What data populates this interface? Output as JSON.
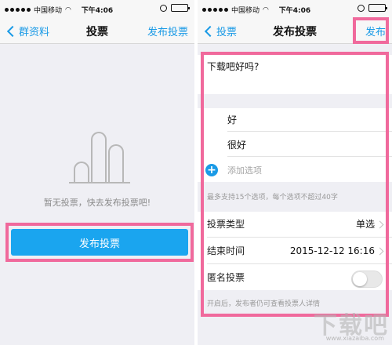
{
  "left": {
    "statusbar": {
      "carrier": "中国移动",
      "time": "下午4:06"
    },
    "navbar": {
      "back_label": "群资料",
      "title": "投票",
      "action_label": "发布投票"
    },
    "empty_text": "暂无投票，快去发布投票吧!",
    "publish_button": "发布投票"
  },
  "right": {
    "statusbar": {
      "carrier": "中国移动",
      "time": "下午4:06"
    },
    "navbar": {
      "back_label": "投票",
      "title": "发布投票",
      "action_label": "发布"
    },
    "question": "下载吧好吗?",
    "options": [
      "好",
      "很好"
    ],
    "add_option_placeholder": "添加选项",
    "options_hint": "最多支持15个选项，每个选项不超过40字",
    "settings": {
      "vote_type_label": "投票类型",
      "vote_type_value": "单选",
      "end_time_label": "结束时间",
      "end_time_value": "2015-12-12 16:16",
      "anonymous_label": "匿名投票",
      "anonymous_on": false
    },
    "anonymous_hint": "开启后，发布者仍可查看投票人详情"
  },
  "watermark": {
    "url": "www.xiazaiba.com"
  },
  "colors": {
    "accent": "#1a9ae6",
    "button": "#1aa5ef",
    "highlight": "#f0699c"
  }
}
